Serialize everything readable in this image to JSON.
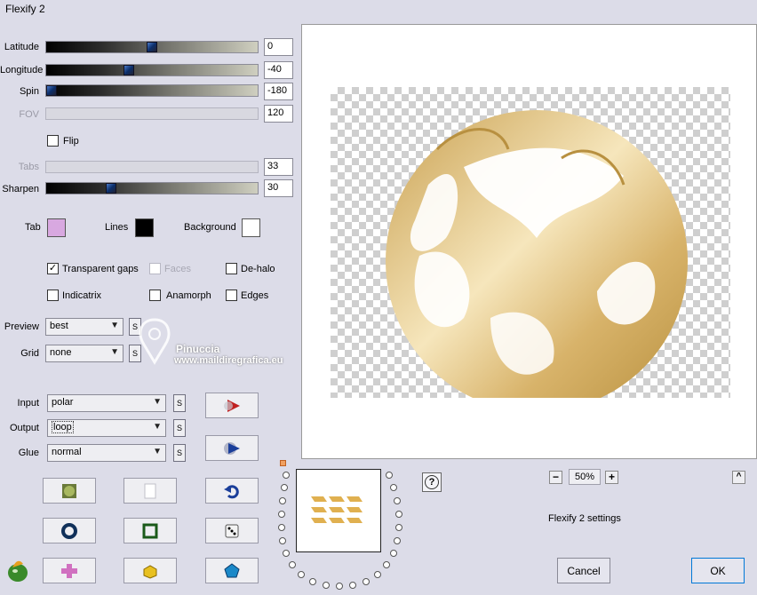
{
  "window": {
    "title": "Flexify 2"
  },
  "params": {
    "latitude": {
      "label": "Latitude",
      "value": "0",
      "level": 0.5
    },
    "longitude": {
      "label": "Longitude",
      "value": "-40",
      "level": 0.39
    },
    "spin": {
      "label": "Spin",
      "value": "-180",
      "level": 0.0
    },
    "fov": {
      "label": "FOV",
      "value": "120"
    },
    "flip": {
      "label": "Flip"
    },
    "tabs": {
      "label": "Tabs",
      "value": "33"
    },
    "sharpen": {
      "label": "Sharpen",
      "value": "30",
      "level": 0.3
    }
  },
  "colors": {
    "tab": {
      "label": "Tab",
      "hex": "#d8a8e0"
    },
    "lines": {
      "label": "Lines",
      "hex": "#000000"
    },
    "background": {
      "label": "Background",
      "hex": "#ffffff"
    }
  },
  "options": {
    "transparent_gaps": {
      "label": "Transparent gaps",
      "checked": "✓"
    },
    "faces": {
      "label": "Faces"
    },
    "de_halo": {
      "label": "De-halo"
    },
    "indicatrix": {
      "label": "Indicatrix"
    },
    "anamorph": {
      "label": "Anamorph"
    },
    "edges": {
      "label": "Edges"
    }
  },
  "selects": {
    "preview": {
      "label": "Preview",
      "value": "best"
    },
    "grid": {
      "label": "Grid",
      "value": "none"
    },
    "input": {
      "label": "Input",
      "value": "polar"
    },
    "output": {
      "label": "Output",
      "value": "loop"
    },
    "glue": {
      "label": "Glue",
      "value": "normal"
    },
    "s_label": "S"
  },
  "watermark": {
    "line1": "Pinuccia",
    "line2": "www.maildiregrafica.eu"
  },
  "zoom": {
    "value": "50%",
    "minus": "−",
    "plus": "+"
  },
  "help": "?",
  "settings_name": "Flexify 2 settings",
  "buttons": {
    "cancel": "Cancel",
    "ok": "OK",
    "collapse": "^"
  },
  "accent": {
    "gold": "#d9b56a",
    "dialog_bg": "#dcdce8"
  }
}
